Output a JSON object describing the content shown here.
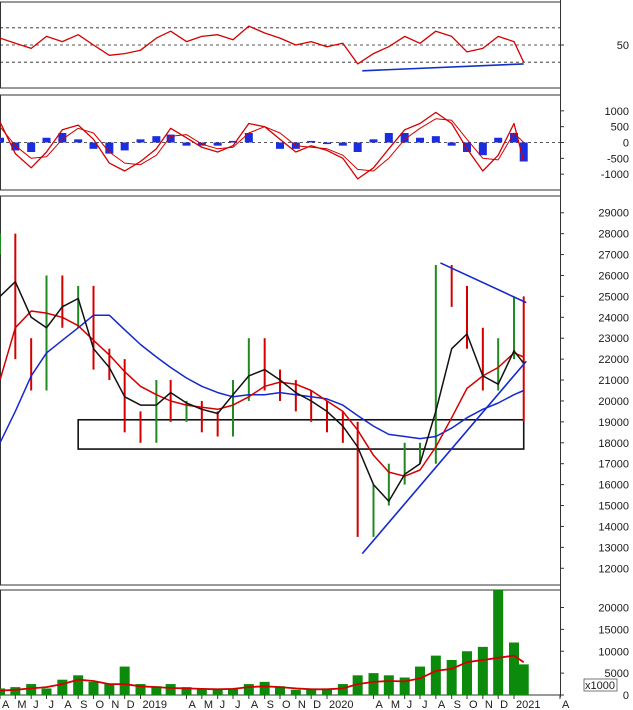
{
  "chart_data": [
    {
      "type": "line",
      "panel": "rsi",
      "ylim": [
        0,
        100
      ],
      "y_ticks": [
        50
      ],
      "reference_levels": [
        30,
        50,
        70
      ],
      "colors": {
        "line": "#d40000",
        "trend": "#1030c8",
        "dashed": "#222222"
      },
      "trendline": {
        "x": [
          "2020-03-10",
          "2021-01-20"
        ],
        "y": [
          20,
          28
        ]
      },
      "series": [
        {
          "x": [
            "2018-04",
            "2018-05",
            "2018-06",
            "2018-07",
            "2018-08",
            "2018-09",
            "2018-10",
            "2018-11",
            "2018-12",
            "2019-01",
            "2019-02",
            "2019-03",
            "2019-04",
            "2019-05",
            "2019-06",
            "2019-07",
            "2019-08",
            "2019-09",
            "2019-10",
            "2019-11",
            "2019-12",
            "2020-01",
            "2020-02",
            "2020-03",
            "2020-04",
            "2020-05",
            "2020-06",
            "2020-07",
            "2020-08",
            "2020-09",
            "2020-10",
            "2020-11",
            "2020-12",
            "2021-01",
            "2021-01-20"
          ],
          "values": [
            58,
            52,
            46,
            60,
            54,
            62,
            50,
            38,
            40,
            44,
            58,
            66,
            54,
            60,
            62,
            56,
            72,
            64,
            58,
            50,
            54,
            48,
            52,
            28,
            40,
            48,
            60,
            52,
            66,
            60,
            42,
            46,
            60,
            54,
            30
          ]
        }
      ]
    },
    {
      "type": "line",
      "panel": "macd",
      "ylim": [
        -1500,
        1500
      ],
      "y_ticks": [
        1000,
        500,
        0,
        -500,
        -1000
      ],
      "colors": {
        "macd": "#d40000",
        "signal": "#d40000",
        "histogram": "#1a2ee0"
      },
      "series": [
        {
          "x": [
            "2018-04",
            "2018-05",
            "2018-06",
            "2018-07",
            "2018-08",
            "2018-09",
            "2018-10",
            "2018-11",
            "2018-12",
            "2019-01",
            "2019-02",
            "2019-03",
            "2019-04",
            "2019-05",
            "2019-06",
            "2019-07",
            "2019-08",
            "2019-09",
            "2019-10",
            "2019-11",
            "2019-12",
            "2020-01",
            "2020-02",
            "2020-03",
            "2020-04",
            "2020-05",
            "2020-06",
            "2020-07",
            "2020-08",
            "2020-09",
            "2020-10",
            "2020-11",
            "2020-12",
            "2021-01",
            "2021-01-20"
          ],
          "values": [
            650,
            -350,
            -800,
            -300,
            400,
            550,
            100,
            -650,
            -900,
            -600,
            -200,
            450,
            150,
            -150,
            -300,
            -100,
            600,
            500,
            100,
            -300,
            -100,
            -250,
            -500,
            -1150,
            -800,
            -200,
            400,
            600,
            950,
            600,
            -200,
            -900,
            -400,
            600,
            -600
          ]
        },
        {
          "x": [
            "2018-04",
            "2018-05",
            "2018-06",
            "2018-07",
            "2018-08",
            "2018-09",
            "2018-10",
            "2018-11",
            "2018-12",
            "2019-01",
            "2019-02",
            "2019-03",
            "2019-04",
            "2019-05",
            "2019-06",
            "2019-07",
            "2019-08",
            "2019-09",
            "2019-10",
            "2019-11",
            "2019-12",
            "2020-01",
            "2020-02",
            "2020-03",
            "2020-04",
            "2020-05",
            "2020-06",
            "2020-07",
            "2020-08",
            "2020-09",
            "2020-10",
            "2020-11",
            "2020-12",
            "2021-01",
            "2021-01-20"
          ],
          "values": [
            500,
            -100,
            -500,
            -450,
            100,
            450,
            300,
            -300,
            -650,
            -700,
            -400,
            200,
            250,
            -50,
            -200,
            -150,
            300,
            500,
            300,
            -100,
            -150,
            -200,
            -400,
            -850,
            -900,
            -500,
            100,
            450,
            750,
            700,
            100,
            -500,
            -550,
            300,
            0
          ]
        },
        {
          "x": [
            "2018-04",
            "2018-05",
            "2018-06",
            "2018-07",
            "2018-08",
            "2018-09",
            "2018-10",
            "2018-11",
            "2018-12",
            "2019-01",
            "2019-02",
            "2019-03",
            "2019-04",
            "2019-05",
            "2019-06",
            "2019-07",
            "2019-08",
            "2019-09",
            "2019-10",
            "2019-11",
            "2019-12",
            "2020-01",
            "2020-02",
            "2020-03",
            "2020-04",
            "2020-05",
            "2020-06",
            "2020-07",
            "2020-08",
            "2020-09",
            "2020-10",
            "2020-11",
            "2020-12",
            "2021-01",
            "2021-01-20"
          ],
          "values": [
            150,
            -250,
            -300,
            150,
            300,
            100,
            -200,
            -350,
            -250,
            100,
            200,
            250,
            -100,
            -100,
            -100,
            50,
            300,
            0,
            -200,
            -200,
            50,
            -50,
            -100,
            -300,
            100,
            300,
            300,
            150,
            200,
            -100,
            -300,
            -400,
            150,
            300,
            -600
          ]
        }
      ]
    },
    {
      "type": "line",
      "panel": "price",
      "ylim": [
        11200,
        29800
      ],
      "y_ticks": [
        29000,
        28000,
        27000,
        26000,
        25000,
        24000,
        23000,
        22000,
        21000,
        20000,
        19000,
        18000,
        17000,
        16000,
        15000,
        14000,
        13000,
        12000
      ],
      "colors": {
        "up": "#1f8a1f",
        "down": "#d40000",
        "ma_short": "#111111",
        "ma_mid": "#d40000",
        "ma_long": "#1428d0",
        "lines": "#1428d0",
        "box": "#111111"
      },
      "support_box": {
        "x": [
          "2018-09",
          "2021-01-20"
        ],
        "y": [
          17700,
          19100
        ]
      },
      "resistance_line": {
        "x": [
          "2020-08-10",
          "2021-01-25"
        ],
        "y": [
          26600,
          24700
        ]
      },
      "support_line": {
        "x": [
          "2020-03-10",
          "2021-01-25"
        ],
        "y": [
          12700,
          21900
        ]
      },
      "series": [
        {
          "name": "close",
          "x": [
            "2018-04",
            "2018-05",
            "2018-06",
            "2018-07",
            "2018-08",
            "2018-09",
            "2018-10",
            "2018-11",
            "2018-12",
            "2019-01",
            "2019-02",
            "2019-03",
            "2019-04",
            "2019-05",
            "2019-06",
            "2019-07",
            "2019-08",
            "2019-09",
            "2019-10",
            "2019-11",
            "2019-12",
            "2020-01",
            "2020-02",
            "2020-03",
            "2020-04",
            "2020-05",
            "2020-06",
            "2020-07",
            "2020-08",
            "2020-09",
            "2020-10",
            "2020-11",
            "2020-12",
            "2021-01",
            "2021-01-20"
          ],
          "values": [
            27500,
            22500,
            21000,
            25500,
            24000,
            25000,
            22000,
            21500,
            19000,
            18500,
            20500,
            19500,
            19500,
            19000,
            18800,
            20500,
            22500,
            21000,
            20500,
            20000,
            19500,
            19000,
            18500,
            14000,
            15500,
            16500,
            17500,
            17500,
            26000,
            25000,
            23000,
            21000,
            22500,
            24500,
            19500
          ]
        },
        {
          "name": "ma_short",
          "x": [
            "2018-04",
            "2018-05",
            "2018-06",
            "2018-07",
            "2018-08",
            "2018-09",
            "2018-10",
            "2018-11",
            "2018-12",
            "2019-01",
            "2019-02",
            "2019-03",
            "2019-04",
            "2019-05",
            "2019-06",
            "2019-07",
            "2019-08",
            "2019-09",
            "2019-10",
            "2019-11",
            "2019-12",
            "2020-01",
            "2020-02",
            "2020-03",
            "2020-04",
            "2020-05",
            "2020-06",
            "2020-07",
            "2020-08",
            "2020-09",
            "2020-10",
            "2020-11",
            "2020-12",
            "2021-01",
            "2021-01-20"
          ],
          "values": [
            25000,
            25700,
            24000,
            23500,
            24500,
            24900,
            22500,
            21600,
            20200,
            19800,
            19800,
            20400,
            19900,
            19600,
            19400,
            20300,
            21200,
            21500,
            21000,
            20400,
            20000,
            19500,
            18800,
            17800,
            16000,
            15200,
            16500,
            17000,
            19500,
            22500,
            23200,
            21200,
            20800,
            22400,
            21800
          ]
        },
        {
          "name": "ma_mid",
          "x": [
            "2018-04",
            "2018-05",
            "2018-06",
            "2018-07",
            "2018-08",
            "2018-09",
            "2018-10",
            "2018-11",
            "2018-12",
            "2019-01",
            "2019-02",
            "2019-03",
            "2019-04",
            "2019-05",
            "2019-06",
            "2019-07",
            "2019-08",
            "2019-09",
            "2019-10",
            "2019-11",
            "2019-12",
            "2020-01",
            "2020-02",
            "2020-03",
            "2020-04",
            "2020-05",
            "2020-06",
            "2020-07",
            "2020-08",
            "2020-09",
            "2020-10",
            "2020-11",
            "2020-12",
            "2021-01",
            "2021-01-20"
          ],
          "values": [
            21000,
            23500,
            24300,
            24200,
            24000,
            23600,
            22900,
            22200,
            21400,
            20700,
            20300,
            20000,
            19800,
            19700,
            19600,
            19800,
            20200,
            20700,
            20900,
            20800,
            20500,
            20000,
            19500,
            18600,
            17400,
            16600,
            16400,
            16700,
            17800,
            19200,
            20600,
            21200,
            21600,
            22300,
            22100
          ]
        },
        {
          "name": "ma_long",
          "x": [
            "2018-04",
            "2018-05",
            "2018-06",
            "2018-07",
            "2018-08",
            "2018-09",
            "2018-10",
            "2018-11",
            "2018-12",
            "2019-01",
            "2019-02",
            "2019-03",
            "2019-04",
            "2019-05",
            "2019-06",
            "2019-07",
            "2019-08",
            "2019-09",
            "2019-10",
            "2019-11",
            "2019-12",
            "2020-01",
            "2020-02",
            "2020-03",
            "2020-04",
            "2020-05",
            "2020-06",
            "2020-07",
            "2020-08",
            "2020-09",
            "2020-10",
            "2020-11",
            "2020-12",
            "2021-01",
            "2021-01-20"
          ],
          "values": [
            18000,
            19500,
            21200,
            22300,
            22900,
            23500,
            24100,
            24100,
            23400,
            22700,
            22100,
            21600,
            21100,
            20700,
            20400,
            20200,
            20300,
            20300,
            20400,
            20300,
            20200,
            20100,
            19800,
            19300,
            18800,
            18400,
            18300,
            18200,
            18300,
            18700,
            19200,
            19600,
            19900,
            20300,
            20500
          ]
        }
      ]
    },
    {
      "type": "bar",
      "panel": "volume",
      "ylim": [
        0,
        24000
      ],
      "y_ticks": [
        20000,
        15000,
        10000,
        5000,
        0
      ],
      "unit_label": "x1000",
      "colors": {
        "bars": "#0b8a0b",
        "ma": "#d40000"
      },
      "series": [
        {
          "name": "volume",
          "x": [
            "2018-04",
            "2018-05",
            "2018-06",
            "2018-07",
            "2018-08",
            "2018-09",
            "2018-10",
            "2018-11",
            "2018-12",
            "2019-01",
            "2019-02",
            "2019-03",
            "2019-04",
            "2019-05",
            "2019-06",
            "2019-07",
            "2019-08",
            "2019-09",
            "2019-10",
            "2019-11",
            "2019-12",
            "2020-01",
            "2020-02",
            "2020-03",
            "2020-04",
            "2020-05",
            "2020-06",
            "2020-07",
            "2020-08",
            "2020-09",
            "2020-10",
            "2020-11",
            "2020-12",
            "2021-01",
            "2021-01-20"
          ],
          "values": [
            1500,
            1800,
            2500,
            1500,
            3500,
            4500,
            3000,
            2500,
            6500,
            2500,
            2000,
            2500,
            1800,
            1500,
            1500,
            1500,
            2500,
            3000,
            2000,
            1200,
            1500,
            1500,
            2500,
            4500,
            5000,
            4500,
            4000,
            6500,
            9000,
            8000,
            10000,
            11000,
            24000,
            12000,
            7000
          ]
        },
        {
          "name": "volume_ma",
          "x": [
            "2018-04",
            "2018-05",
            "2018-06",
            "2018-07",
            "2018-08",
            "2018-09",
            "2018-10",
            "2018-11",
            "2018-12",
            "2019-01",
            "2019-02",
            "2019-03",
            "2019-04",
            "2019-05",
            "2019-06",
            "2019-07",
            "2019-08",
            "2019-09",
            "2019-10",
            "2019-11",
            "2019-12",
            "2020-01",
            "2020-02",
            "2020-03",
            "2020-04",
            "2020-05",
            "2020-06",
            "2020-07",
            "2020-08",
            "2020-09",
            "2020-10",
            "2020-11",
            "2020-12",
            "2021-01",
            "2021-01-20"
          ],
          "values": [
            1000,
            1200,
            1500,
            1800,
            2500,
            3500,
            3200,
            2500,
            2500,
            2000,
            1800,
            1600,
            1500,
            1400,
            1300,
            1400,
            1800,
            2000,
            1800,
            1500,
            1300,
            1300,
            1500,
            2500,
            3000,
            3200,
            3100,
            3800,
            5500,
            6000,
            7500,
            8000,
            8500,
            9000,
            7500
          ]
        }
      ]
    }
  ],
  "x_axis": {
    "labels": [
      "A",
      "M",
      "J",
      "J",
      "A",
      "S",
      "O",
      "N",
      "D",
      "2019",
      "A",
      "M",
      "J",
      "J",
      "A",
      "S",
      "O",
      "N",
      "D",
      "2020",
      "A",
      "M",
      "J",
      "J",
      "A",
      "S",
      "O",
      "N",
      "D",
      "2021",
      "A"
    ],
    "dates": [
      "2018-04",
      "2018-05",
      "2018-06",
      "2018-07",
      "2018-08",
      "2018-09",
      "2018-10",
      "2018-11",
      "2018-12",
      "2019-01",
      "2019-04",
      "2019-05",
      "2019-06",
      "2019-07",
      "2019-08",
      "2019-09",
      "2019-10",
      "2019-11",
      "2019-12",
      "2020-01",
      "2020-04",
      "2020-05",
      "2020-06",
      "2020-07",
      "2020-08",
      "2020-09",
      "2020-10",
      "2020-11",
      "2020-12",
      "2021-01",
      "2021-04"
    ],
    "range": [
      "2018-04",
      "2021-04"
    ]
  }
}
